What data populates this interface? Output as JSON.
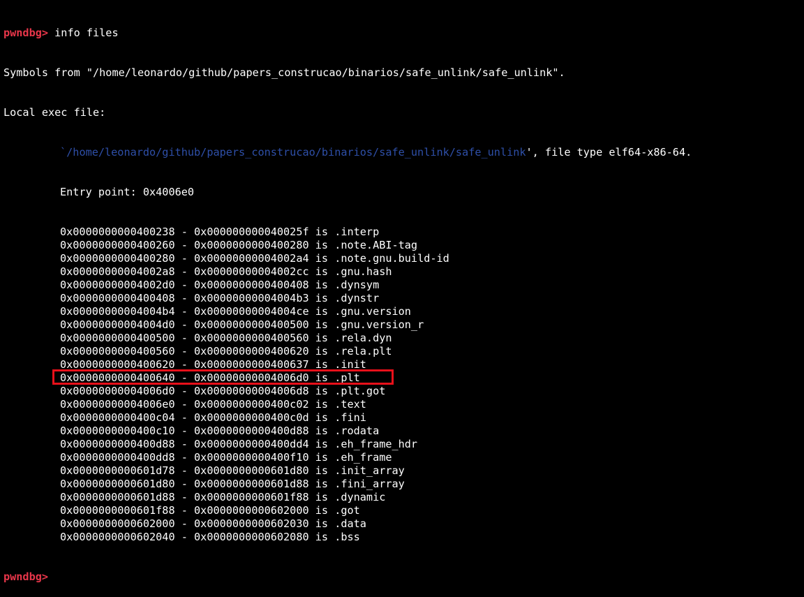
{
  "prompt": {
    "label": "pwndbg>",
    "command": " info files"
  },
  "header": {
    "symbols_line": "Symbols from \"/home/leonardo/github/papers_construcao/binarios/safe_unlink/safe_unlink\".",
    "local_exec": "Local exec file:",
    "exec_quote_open": "`",
    "exec_path": "/home/leonardo/github/papers_construcao/binarios/safe_unlink/safe_unlink",
    "exec_suffix": "', file type elf64-x86-64.",
    "entry_point": "Entry point: 0x4006e0"
  },
  "sections": [
    {
      "start": "0x0000000000400238",
      "end": "0x000000000040025f",
      "name": ".interp"
    },
    {
      "start": "0x0000000000400260",
      "end": "0x0000000000400280",
      "name": ".note.ABI-tag"
    },
    {
      "start": "0x0000000000400280",
      "end": "0x00000000004002a4",
      "name": ".note.gnu.build-id"
    },
    {
      "start": "0x00000000004002a8",
      "end": "0x00000000004002cc",
      "name": ".gnu.hash"
    },
    {
      "start": "0x00000000004002d0",
      "end": "0x0000000000400408",
      "name": ".dynsym"
    },
    {
      "start": "0x0000000000400408",
      "end": "0x00000000004004b3",
      "name": ".dynstr"
    },
    {
      "start": "0x00000000004004b4",
      "end": "0x00000000004004ce",
      "name": ".gnu.version"
    },
    {
      "start": "0x00000000004004d0",
      "end": "0x0000000000400500",
      "name": ".gnu.version_r"
    },
    {
      "start": "0x0000000000400500",
      "end": "0x0000000000400560",
      "name": ".rela.dyn"
    },
    {
      "start": "0x0000000000400560",
      "end": "0x0000000000400620",
      "name": ".rela.plt"
    },
    {
      "start": "0x0000000000400620",
      "end": "0x0000000000400637",
      "name": ".init"
    },
    {
      "start": "0x0000000000400640",
      "end": "0x00000000004006d0",
      "name": ".plt"
    },
    {
      "start": "0x00000000004006d0",
      "end": "0x00000000004006d8",
      "name": ".plt.got"
    },
    {
      "start": "0x00000000004006e0",
      "end": "0x0000000000400c02",
      "name": ".text"
    },
    {
      "start": "0x0000000000400c04",
      "end": "0x0000000000400c0d",
      "name": ".fini"
    },
    {
      "start": "0x0000000000400c10",
      "end": "0x0000000000400d88",
      "name": ".rodata"
    },
    {
      "start": "0x0000000000400d88",
      "end": "0x0000000000400dd4",
      "name": ".eh_frame_hdr"
    },
    {
      "start": "0x0000000000400dd8",
      "end": "0x0000000000400f10",
      "name": ".eh_frame"
    },
    {
      "start": "0x0000000000601d78",
      "end": "0x0000000000601d80",
      "name": ".init_array"
    },
    {
      "start": "0x0000000000601d80",
      "end": "0x0000000000601d88",
      "name": ".fini_array"
    },
    {
      "start": "0x0000000000601d88",
      "end": "0x0000000000601f88",
      "name": ".dynamic"
    },
    {
      "start": "0x0000000000601f88",
      "end": "0x0000000000602000",
      "name": ".got"
    },
    {
      "start": "0x0000000000602000",
      "end": "0x0000000000602030",
      "name": ".data"
    },
    {
      "start": "0x0000000000602040",
      "end": "0x0000000000602080",
      "name": ".bss"
    }
  ],
  "separator": " - ",
  "is_word": " is ",
  "footer_prompt": "pwndbg>",
  "colors": {
    "prompt": "#e8364a",
    "path": "#2e4fa8",
    "highlight_box": "#e8101a",
    "text": "#ffffff",
    "background": "#000000"
  }
}
